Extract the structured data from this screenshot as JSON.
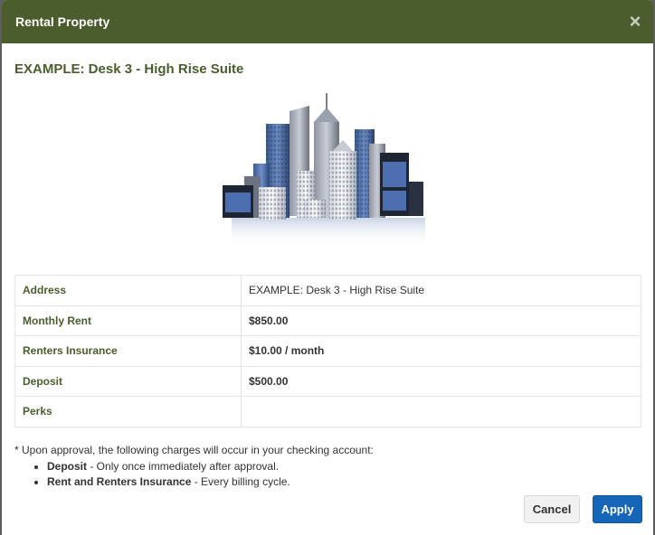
{
  "modal": {
    "title": "Rental Property",
    "close_symbol": "×"
  },
  "property": {
    "name": "EXAMPLE: Desk 3 - High Rise Suite",
    "image_icon": "city-skyline-icon"
  },
  "details": [
    {
      "label": "Address",
      "value": "EXAMPLE: Desk 3 - High Rise Suite"
    },
    {
      "label": "Monthly Rent",
      "value": "$850.00"
    },
    {
      "label": "Renters Insurance",
      "value": "$10.00 / month"
    },
    {
      "label": "Deposit",
      "value": "$500.00"
    },
    {
      "label": "Perks",
      "value": ""
    }
  ],
  "note": {
    "intro": "* Upon approval, the following charges will occur in your checking account:",
    "items": [
      {
        "term": "Deposit",
        "text": " - Only once immediately after approval."
      },
      {
        "term": "Rent and Renters Insurance",
        "text": " - Every billing cycle."
      }
    ]
  },
  "footer": {
    "cancel_label": "Cancel",
    "apply_label": "Apply"
  },
  "colors": {
    "header": "#4b5d2d",
    "label": "#4b5d2d",
    "primary_button": "#1565b8"
  }
}
